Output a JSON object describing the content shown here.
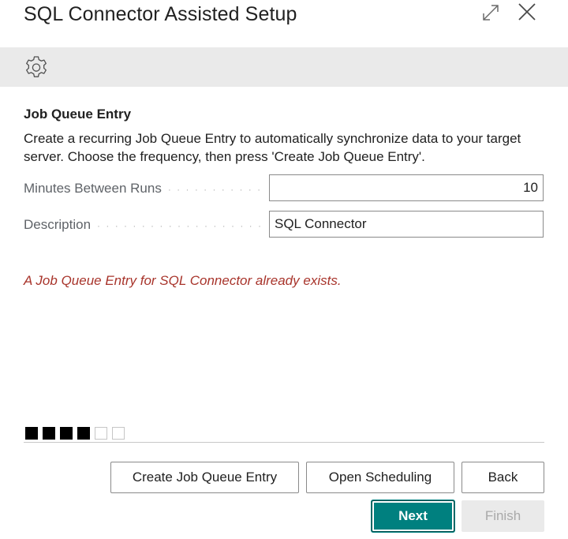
{
  "window": {
    "title": "SQL Connector Assisted Setup",
    "expand_icon": "expand-icon",
    "close_icon": "close-icon"
  },
  "toolbar": {
    "settings_icon": "gear-icon"
  },
  "section": {
    "title": "Job Queue Entry",
    "description": "Create a recurring Job Queue Entry to automatically synchronize data to your target server. Choose the frequency, then press 'Create Job Queue Entry'."
  },
  "fields": {
    "minutes": {
      "label": "Minutes Between Runs",
      "value": "10"
    },
    "description": {
      "label": "Description",
      "value": "SQL Connector"
    }
  },
  "warning": "A Job Queue Entry for SQL Connector already exists.",
  "progress": {
    "total_steps": 6,
    "completed_steps": 4
  },
  "buttons": {
    "create": "Create Job Queue Entry",
    "scheduling": "Open Scheduling",
    "back": "Back",
    "next": "Next",
    "finish": "Finish"
  },
  "colors": {
    "accent": "#00807f",
    "warning": "#a8342b",
    "toolbar_bg": "#eaeaea"
  }
}
